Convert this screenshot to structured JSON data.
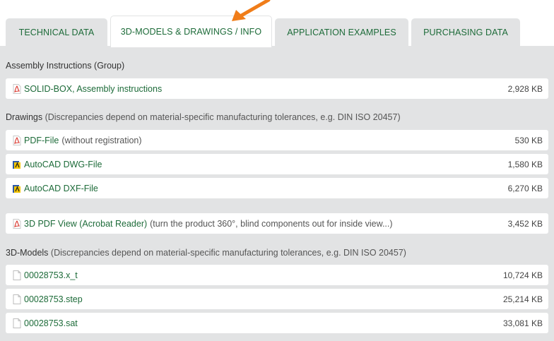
{
  "tabs": [
    {
      "label": "TECHNICAL DATA"
    },
    {
      "label": "3D-MODELS & DRAWINGS / INFO"
    },
    {
      "label": "APPLICATION EXAMPLES"
    },
    {
      "label": "PURCHASING DATA"
    }
  ],
  "colors": {
    "accent": "#1d6b39",
    "panel": "#e2e3e4",
    "arrow": "#f07d19",
    "pdf": "#d9342b"
  },
  "sections": {
    "assembly": {
      "title": "Assembly Instructions (Group)"
    },
    "drawings": {
      "title": "Drawings",
      "note": "(Discrepancies depend on material-specific manufacturing tolerances, e.g. DIN ISO 20457)"
    },
    "models": {
      "title": "3D-Models",
      "note": "(Discrepancies depend on material-specific manufacturing tolerances, e.g. DIN ISO 20457)"
    }
  },
  "files": {
    "assembly_pdf": {
      "icon": "pdf-icon",
      "label": "SOLID-BOX, Assembly instructions",
      "desc": "",
      "size": "2,928 KB"
    },
    "pdf_file": {
      "icon": "pdf-icon",
      "label": "PDF-File",
      "desc": "(without registration)",
      "size": "530 KB"
    },
    "dwg_file": {
      "icon": "autocad-icon",
      "label": "AutoCAD DWG-File",
      "desc": "",
      "size": "1,580 KB"
    },
    "dxf_file": {
      "icon": "autocad-icon",
      "label": "AutoCAD DXF-File",
      "desc": "",
      "size": "6,270 KB"
    },
    "pdf3d": {
      "icon": "pdf-icon",
      "label": "3D PDF View (Acrobat Reader)",
      "desc": "(turn the product 360°, blind components out for inside view...)",
      "size": "3,452 KB"
    },
    "x_t": {
      "icon": "file-icon",
      "label": "00028753.x_t",
      "desc": "",
      "size": "10,724 KB"
    },
    "step": {
      "icon": "file-icon",
      "label": "00028753.step",
      "desc": "",
      "size": "25,214 KB"
    },
    "sat": {
      "icon": "file-icon",
      "label": "00028753.sat",
      "desc": "",
      "size": "33,081 KB"
    }
  }
}
